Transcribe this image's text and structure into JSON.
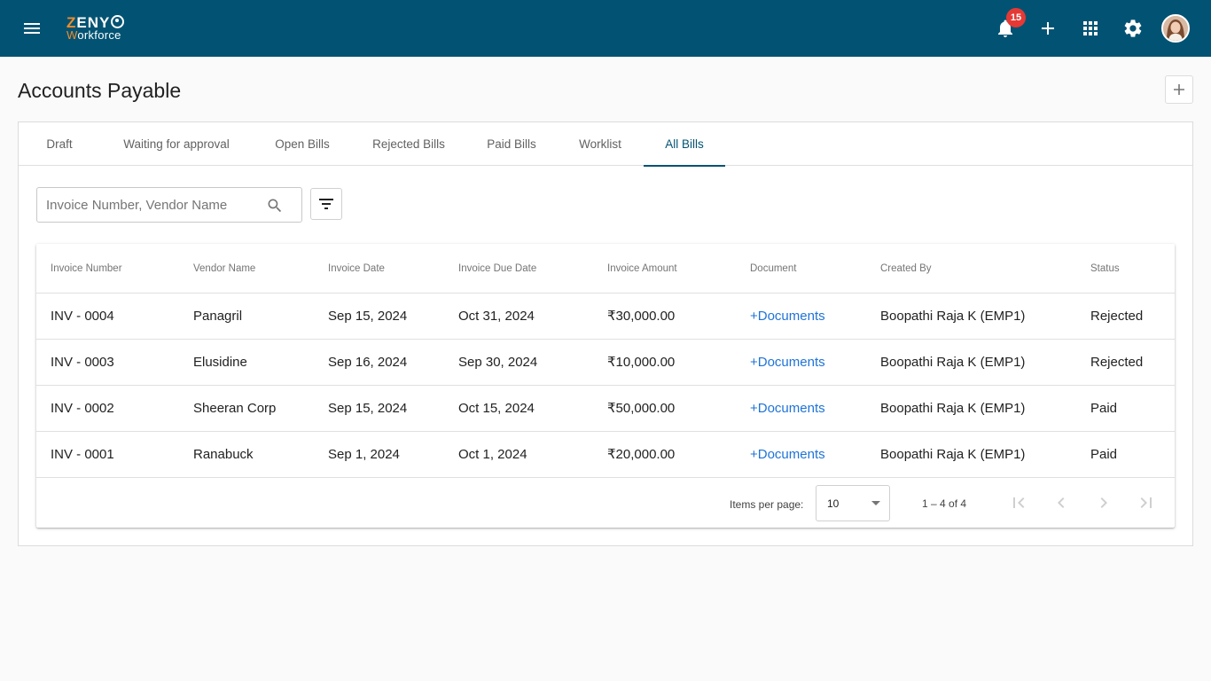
{
  "app": {
    "logo_main": "ZENY",
    "logo_sub": "Workforce",
    "notification_count": "15"
  },
  "page": {
    "title": "Accounts Payable"
  },
  "tabs": [
    {
      "label": "Draft"
    },
    {
      "label": "Waiting for approval"
    },
    {
      "label": "Open Bills"
    },
    {
      "label": "Rejected Bills"
    },
    {
      "label": "Paid Bills"
    },
    {
      "label": "Worklist"
    },
    {
      "label": "All Bills",
      "active": true
    }
  ],
  "search": {
    "placeholder": "Invoice Number, Vendor Name",
    "value": ""
  },
  "table": {
    "columns": [
      "Invoice Number",
      "Vendor Name",
      "Invoice Date",
      "Invoice Due Date",
      "Invoice Amount",
      "Document",
      "Created By",
      "Status"
    ],
    "rows": [
      {
        "invoice": "INV - 0004",
        "vendor": "Panagril",
        "date": "Sep 15, 2024",
        "due": "Oct 31, 2024",
        "amount": "₹30,000.00",
        "document": "+Documents",
        "created_by": "Boopathi Raja K (EMP1)",
        "status": "Rejected"
      },
      {
        "invoice": "INV - 0003",
        "vendor": "Elusidine",
        "date": "Sep 16, 2024",
        "due": "Sep 30, 2024",
        "amount": "₹10,000.00",
        "document": "+Documents",
        "created_by": "Boopathi Raja K (EMP1)",
        "status": "Rejected"
      },
      {
        "invoice": "INV - 0002",
        "vendor": "Sheeran Corp",
        "date": "Sep 15, 2024",
        "due": "Oct 15, 2024",
        "amount": "₹50,000.00",
        "document": "+Documents",
        "created_by": "Boopathi Raja K (EMP1)",
        "status": "Paid"
      },
      {
        "invoice": "INV - 0001",
        "vendor": "Ranabuck",
        "date": "Sep 1, 2024",
        "due": "Oct 1, 2024",
        "amount": "₹20,000.00",
        "document": "+Documents",
        "created_by": "Boopathi Raja K (EMP1)",
        "status": "Paid"
      }
    ]
  },
  "paginator": {
    "items_per_page_label": "Items per page:",
    "page_size": "10",
    "range": "1 – 4 of 4"
  },
  "icons": {
    "menu": "menu-icon",
    "bell": "bell-icon",
    "add": "plus-icon",
    "apps": "apps-grid-icon",
    "settings": "gear-icon",
    "search": "search-icon",
    "filter": "filter-icon",
    "first": "first-page-icon",
    "prev": "chevron-left-icon",
    "next": "chevron-right-icon",
    "last": "last-page-icon"
  },
  "colors": {
    "topbar": "#025373",
    "accent": "#025373",
    "link": "#1e73d8",
    "badge": "#e53935",
    "logo_accent": "#f28c28"
  }
}
